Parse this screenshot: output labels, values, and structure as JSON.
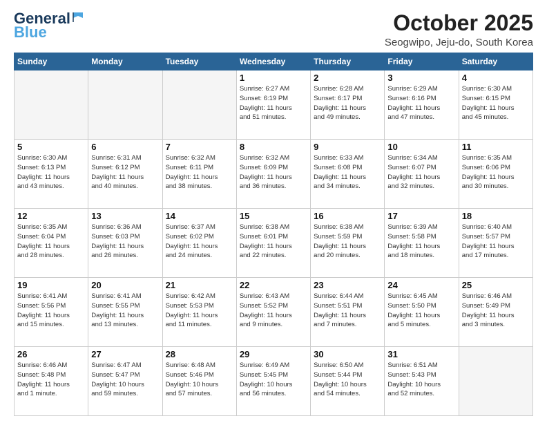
{
  "header": {
    "logo_general": "General",
    "logo_blue": "Blue",
    "month_title": "October 2025",
    "location": "Seogwipo, Jeju-do, South Korea"
  },
  "weekdays": [
    "Sunday",
    "Monday",
    "Tuesday",
    "Wednesday",
    "Thursday",
    "Friday",
    "Saturday"
  ],
  "weeks": [
    [
      {
        "day": "",
        "info": ""
      },
      {
        "day": "",
        "info": ""
      },
      {
        "day": "",
        "info": ""
      },
      {
        "day": "1",
        "info": "Sunrise: 6:27 AM\nSunset: 6:19 PM\nDaylight: 11 hours\nand 51 minutes."
      },
      {
        "day": "2",
        "info": "Sunrise: 6:28 AM\nSunset: 6:17 PM\nDaylight: 11 hours\nand 49 minutes."
      },
      {
        "day": "3",
        "info": "Sunrise: 6:29 AM\nSunset: 6:16 PM\nDaylight: 11 hours\nand 47 minutes."
      },
      {
        "day": "4",
        "info": "Sunrise: 6:30 AM\nSunset: 6:15 PM\nDaylight: 11 hours\nand 45 minutes."
      }
    ],
    [
      {
        "day": "5",
        "info": "Sunrise: 6:30 AM\nSunset: 6:13 PM\nDaylight: 11 hours\nand 43 minutes."
      },
      {
        "day": "6",
        "info": "Sunrise: 6:31 AM\nSunset: 6:12 PM\nDaylight: 11 hours\nand 40 minutes."
      },
      {
        "day": "7",
        "info": "Sunrise: 6:32 AM\nSunset: 6:11 PM\nDaylight: 11 hours\nand 38 minutes."
      },
      {
        "day": "8",
        "info": "Sunrise: 6:32 AM\nSunset: 6:09 PM\nDaylight: 11 hours\nand 36 minutes."
      },
      {
        "day": "9",
        "info": "Sunrise: 6:33 AM\nSunset: 6:08 PM\nDaylight: 11 hours\nand 34 minutes."
      },
      {
        "day": "10",
        "info": "Sunrise: 6:34 AM\nSunset: 6:07 PM\nDaylight: 11 hours\nand 32 minutes."
      },
      {
        "day": "11",
        "info": "Sunrise: 6:35 AM\nSunset: 6:06 PM\nDaylight: 11 hours\nand 30 minutes."
      }
    ],
    [
      {
        "day": "12",
        "info": "Sunrise: 6:35 AM\nSunset: 6:04 PM\nDaylight: 11 hours\nand 28 minutes."
      },
      {
        "day": "13",
        "info": "Sunrise: 6:36 AM\nSunset: 6:03 PM\nDaylight: 11 hours\nand 26 minutes."
      },
      {
        "day": "14",
        "info": "Sunrise: 6:37 AM\nSunset: 6:02 PM\nDaylight: 11 hours\nand 24 minutes."
      },
      {
        "day": "15",
        "info": "Sunrise: 6:38 AM\nSunset: 6:01 PM\nDaylight: 11 hours\nand 22 minutes."
      },
      {
        "day": "16",
        "info": "Sunrise: 6:38 AM\nSunset: 5:59 PM\nDaylight: 11 hours\nand 20 minutes."
      },
      {
        "day": "17",
        "info": "Sunrise: 6:39 AM\nSunset: 5:58 PM\nDaylight: 11 hours\nand 18 minutes."
      },
      {
        "day": "18",
        "info": "Sunrise: 6:40 AM\nSunset: 5:57 PM\nDaylight: 11 hours\nand 17 minutes."
      }
    ],
    [
      {
        "day": "19",
        "info": "Sunrise: 6:41 AM\nSunset: 5:56 PM\nDaylight: 11 hours\nand 15 minutes."
      },
      {
        "day": "20",
        "info": "Sunrise: 6:41 AM\nSunset: 5:55 PM\nDaylight: 11 hours\nand 13 minutes."
      },
      {
        "day": "21",
        "info": "Sunrise: 6:42 AM\nSunset: 5:53 PM\nDaylight: 11 hours\nand 11 minutes."
      },
      {
        "day": "22",
        "info": "Sunrise: 6:43 AM\nSunset: 5:52 PM\nDaylight: 11 hours\nand 9 minutes."
      },
      {
        "day": "23",
        "info": "Sunrise: 6:44 AM\nSunset: 5:51 PM\nDaylight: 11 hours\nand 7 minutes."
      },
      {
        "day": "24",
        "info": "Sunrise: 6:45 AM\nSunset: 5:50 PM\nDaylight: 11 hours\nand 5 minutes."
      },
      {
        "day": "25",
        "info": "Sunrise: 6:46 AM\nSunset: 5:49 PM\nDaylight: 11 hours\nand 3 minutes."
      }
    ],
    [
      {
        "day": "26",
        "info": "Sunrise: 6:46 AM\nSunset: 5:48 PM\nDaylight: 11 hours\nand 1 minute."
      },
      {
        "day": "27",
        "info": "Sunrise: 6:47 AM\nSunset: 5:47 PM\nDaylight: 10 hours\nand 59 minutes."
      },
      {
        "day": "28",
        "info": "Sunrise: 6:48 AM\nSunset: 5:46 PM\nDaylight: 10 hours\nand 57 minutes."
      },
      {
        "day": "29",
        "info": "Sunrise: 6:49 AM\nSunset: 5:45 PM\nDaylight: 10 hours\nand 56 minutes."
      },
      {
        "day": "30",
        "info": "Sunrise: 6:50 AM\nSunset: 5:44 PM\nDaylight: 10 hours\nand 54 minutes."
      },
      {
        "day": "31",
        "info": "Sunrise: 6:51 AM\nSunset: 5:43 PM\nDaylight: 10 hours\nand 52 minutes."
      },
      {
        "day": "",
        "info": ""
      }
    ]
  ]
}
